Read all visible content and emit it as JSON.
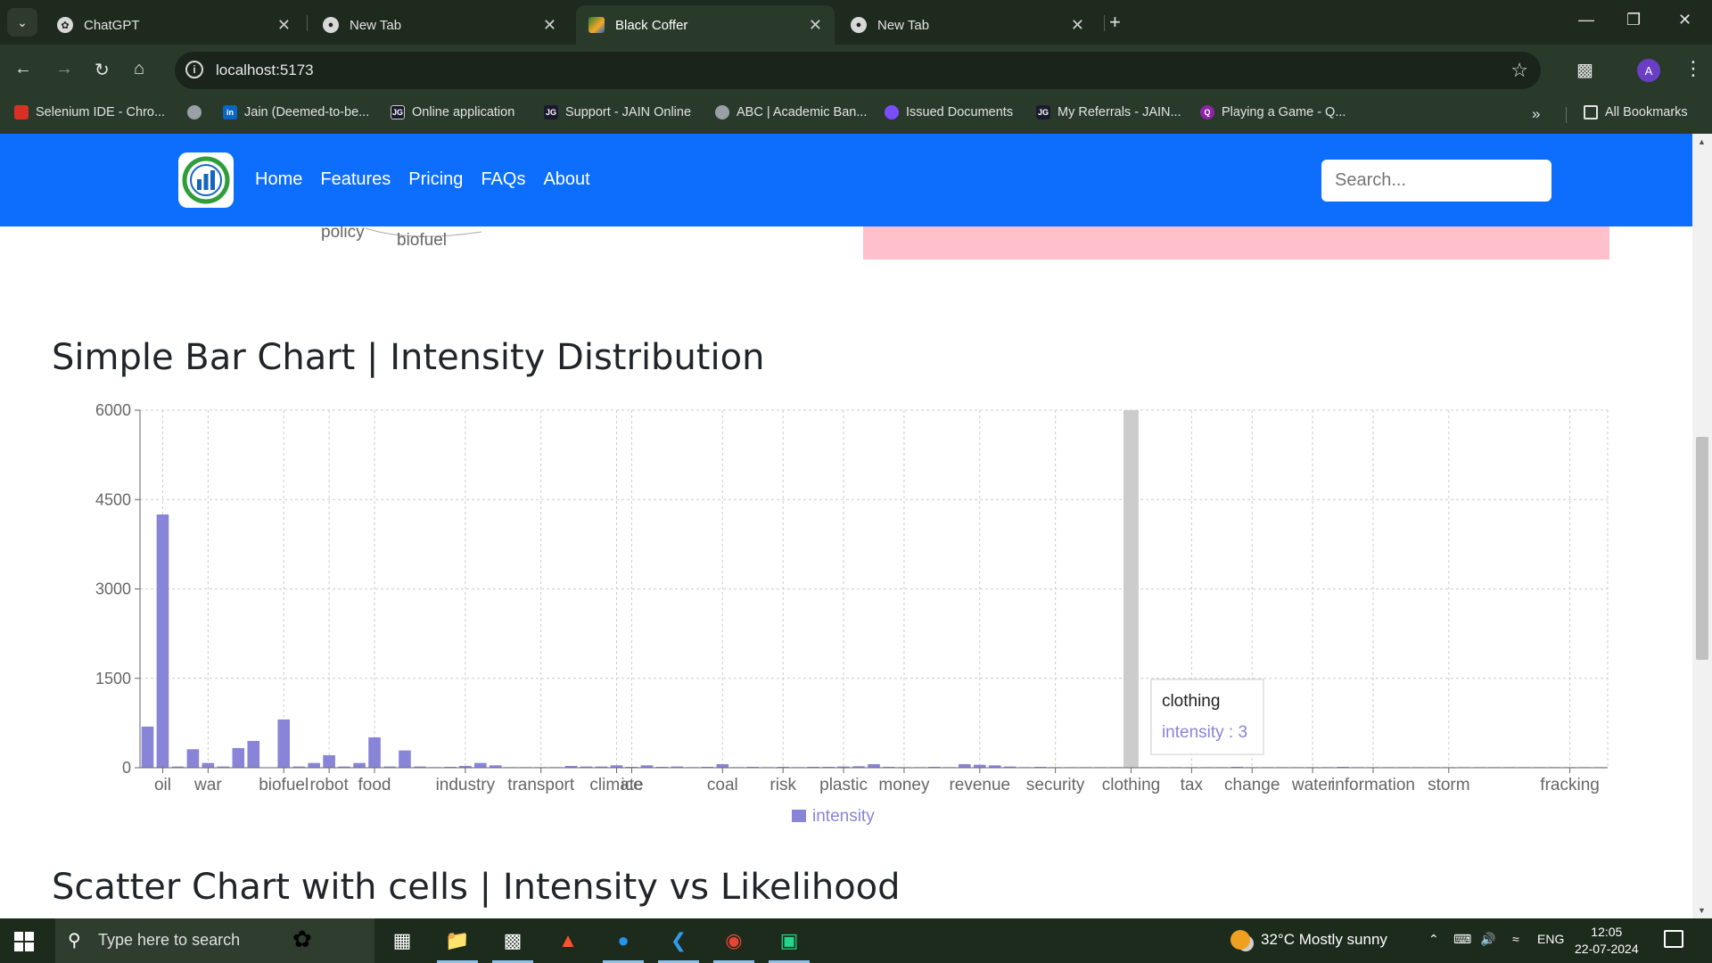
{
  "browser": {
    "tabs": [
      {
        "title": "ChatGPT",
        "active": false
      },
      {
        "title": "New Tab",
        "active": false
      },
      {
        "title": "Black Coffer",
        "active": true
      },
      {
        "title": "New Tab",
        "active": false
      }
    ],
    "url": "localhost:5173",
    "profile_initial": "A",
    "bookmarks": [
      {
        "label": "Selenium IDE - Chro...",
        "icon": "selenium-icon",
        "color": "#d93025"
      },
      {
        "label": "",
        "icon": "globe-icon",
        "color": "#9aa0a6"
      },
      {
        "label": "Jain (Deemed-to-be...",
        "icon": "linkedin-icon",
        "color": "#0a66c2"
      },
      {
        "label": "Online application",
        "icon": "jgi-icon",
        "color": "#1a1a2e"
      },
      {
        "label": "Support - JAIN Online",
        "icon": "jgi-icon",
        "color": "#1a1a2e"
      },
      {
        "label": "ABC | Academic Ban...",
        "icon": "globe-icon",
        "color": "#9aa0a6"
      },
      {
        "label": "Issued Documents",
        "icon": "cloud-icon",
        "color": "#7c4dff"
      },
      {
        "label": "My Referrals - JAIN...",
        "icon": "jgi-icon",
        "color": "#1a1a2e"
      },
      {
        "label": "Playing a Game - Q...",
        "icon": "quiz-icon",
        "color": "#8e24aa"
      }
    ],
    "all_bookmarks": "All Bookmarks"
  },
  "app": {
    "nav_links": [
      "Home",
      "Features",
      "Pricing",
      "FAQs",
      "About"
    ],
    "search_placeholder": "Search...",
    "residual_labels": [
      "policy",
      "biofuel"
    ]
  },
  "sections": {
    "bar_title": "Simple Bar Chart | Intensity Distribution",
    "scatter_title": "Scatter Chart with cells | Intensity vs Likelihood"
  },
  "chart_data": {
    "type": "bar",
    "ylim": [
      0,
      6000
    ],
    "yticks": [
      0,
      1500,
      3000,
      4500,
      6000
    ],
    "grid": true,
    "legend": "bottom",
    "series": [
      {
        "name": "intensity",
        "color": "#8884d8"
      }
    ],
    "categories": [
      "",
      "oil",
      "",
      "",
      "war",
      "",
      "",
      "",
      "",
      "biofuel",
      "",
      "",
      "robot",
      "",
      "",
      "food",
      "",
      "",
      "",
      "",
      "",
      "industry",
      "",
      "",
      "",
      "",
      "transport",
      "",
      "",
      "",
      "",
      "climate",
      "ice",
      "",
      "",
      "",
      "",
      "",
      "coal",
      "",
      "",
      "",
      "risk",
      "",
      "",
      "",
      "plastic",
      "",
      "",
      "",
      "money",
      "",
      "",
      "",
      "",
      "revenue",
      "",
      "",
      "",
      "",
      "security",
      "",
      "",
      "",
      "",
      "clothing",
      "",
      "",
      "",
      "tax",
      "",
      "",
      "",
      "change",
      "",
      "",
      "",
      "water",
      "",
      "",
      "",
      "information",
      "",
      "",
      "",
      "",
      "storm",
      "",
      "",
      "",
      "",
      "",
      "",
      "",
      "fracking"
    ],
    "values": [
      690,
      4250,
      20,
      310,
      80,
      20,
      330,
      450,
      0,
      810,
      20,
      80,
      210,
      20,
      80,
      510,
      20,
      290,
      20,
      10,
      15,
      30,
      80,
      40,
      10,
      10,
      10,
      10,
      30,
      20,
      20,
      40,
      15,
      40,
      15,
      20,
      10,
      15,
      60,
      10,
      15,
      10,
      15,
      10,
      15,
      15,
      20,
      25,
      60,
      15,
      10,
      10,
      15,
      10,
      60,
      50,
      40,
      20,
      10,
      15,
      10,
      10,
      10,
      10,
      10,
      3,
      10,
      10,
      10,
      10,
      10,
      10,
      15,
      10,
      10,
      10,
      10,
      10,
      10,
      15,
      10,
      10,
      10,
      10,
      10,
      10,
      10,
      10,
      10,
      10,
      10,
      10,
      10,
      10,
      10,
      10,
      10
    ],
    "highlight_category": "clothing",
    "tooltip": {
      "category": "clothing",
      "series": "intensity",
      "value": 3
    }
  },
  "taskbar": {
    "search_placeholder": "Type here to search",
    "weather": "32°C  Mostly sunny",
    "language": "ENG",
    "time": "12:05",
    "date": "22-07-2024"
  }
}
